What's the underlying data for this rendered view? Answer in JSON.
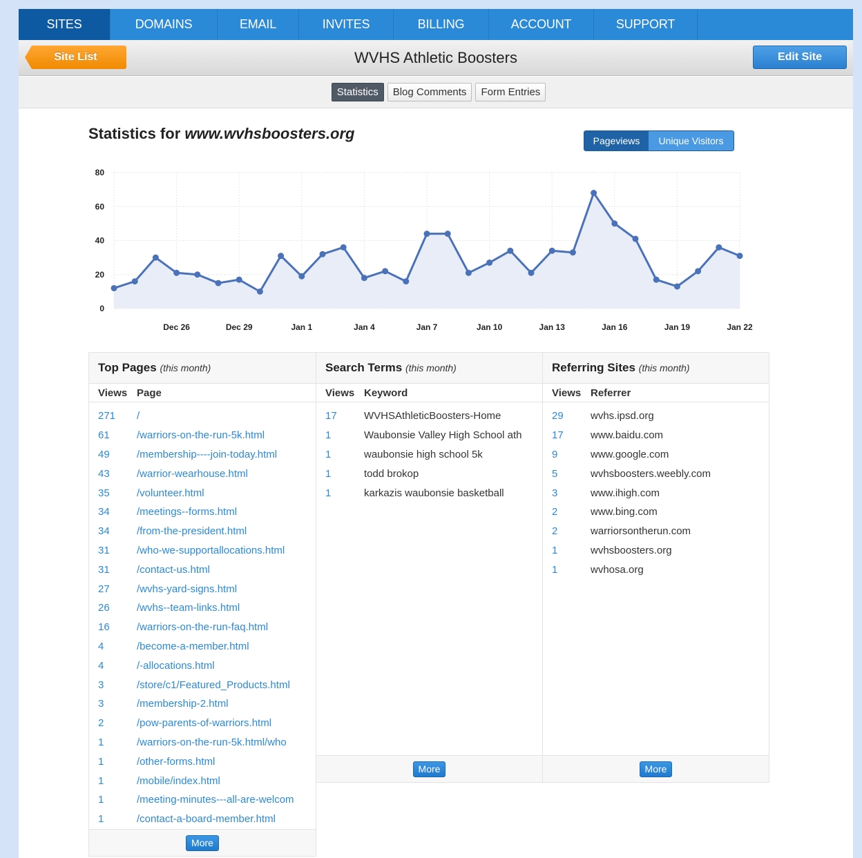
{
  "nav": {
    "items": [
      {
        "label": "SITES",
        "w": 133
      },
      {
        "label": "DOMAINS",
        "w": 155
      },
      {
        "label": "EMAIL",
        "w": 118
      },
      {
        "label": "INVITES",
        "w": 137
      },
      {
        "label": "BILLING",
        "w": 138
      },
      {
        "label": "ACCOUNT",
        "w": 152
      },
      {
        "label": "SUPPORT",
        "w": 150
      }
    ]
  },
  "header": {
    "back_label": "Site List",
    "title": "WVHS Athletic Boosters",
    "edit_label": "Edit Site"
  },
  "subtabs": [
    "Statistics",
    "Blog Comments",
    "Form Entries"
  ],
  "stats": {
    "title_prefix": "Statistics for ",
    "domain": "www.wvhsboosters.org",
    "toggle_pageviews": "Pageviews",
    "toggle_unique": "Unique Visitors"
  },
  "chart_data": {
    "type": "area",
    "x_tick_labels": [
      "Dec 26",
      "Dec 29",
      "Jan 1",
      "Jan 4",
      "Jan 7",
      "Jan 10",
      "Jan 13",
      "Jan 16",
      "Jan 19",
      "Jan 22"
    ],
    "y_ticks": [
      0,
      20,
      40,
      60,
      80
    ],
    "ylim": [
      0,
      80
    ],
    "x_start": "Dec 23",
    "x_end": "Jan 22",
    "values": [
      12,
      16,
      30,
      21,
      20,
      15,
      17,
      10,
      31,
      19,
      32,
      36,
      18,
      22,
      16,
      44,
      44,
      21,
      27,
      34,
      21,
      34,
      33,
      68,
      50,
      41,
      17,
      13,
      22,
      36,
      31
    ],
    "color": "#4a72b8",
    "fill": "#e8edf8",
    "grid": true
  },
  "top_pages": {
    "title": "Top Pages",
    "subtitle": "(this month)",
    "col_views": "Views",
    "col_page": "Page",
    "rows": [
      {
        "views": "271",
        "page": "/"
      },
      {
        "views": "61",
        "page": "/warriors-on-the-run-5k.html"
      },
      {
        "views": "49",
        "page": "/membership----join-today.html"
      },
      {
        "views": "43",
        "page": "/warrior-wearhouse.html"
      },
      {
        "views": "35",
        "page": "/volunteer.html"
      },
      {
        "views": "34",
        "page": "/meetings--forms.html"
      },
      {
        "views": "34",
        "page": "/from-the-president.html"
      },
      {
        "views": "31",
        "page": "/who-we-supportallocations.html"
      },
      {
        "views": "31",
        "page": "/contact-us.html"
      },
      {
        "views": "27",
        "page": "/wvhs-yard-signs.html"
      },
      {
        "views": "26",
        "page": "/wvhs--team-links.html"
      },
      {
        "views": "16",
        "page": "/warriors-on-the-run-faq.html"
      },
      {
        "views": "4",
        "page": "/become-a-member.html"
      },
      {
        "views": "4",
        "page": "/-allocations.html"
      },
      {
        "views": "3",
        "page": "/store/c1/Featured_Products.html"
      },
      {
        "views": "3",
        "page": "/membership-2.html"
      },
      {
        "views": "2",
        "page": "/pow-parents-of-warriors.html"
      },
      {
        "views": "1",
        "page": "/warriors-on-the-run-5k.html/who"
      },
      {
        "views": "1",
        "page": "/other-forms.html"
      },
      {
        "views": "1",
        "page": "/mobile/index.html"
      },
      {
        "views": "1",
        "page": "/meeting-minutes---all-are-welcom"
      },
      {
        "views": "1",
        "page": "/contact-a-board-member.html"
      }
    ],
    "more_label": "More"
  },
  "search_terms": {
    "title": "Search Terms",
    "subtitle": "(this month)",
    "col_views": "Views",
    "col_keyword": "Keyword",
    "rows": [
      {
        "views": "17",
        "keyword": "WVHSAthleticBoosters-Home"
      },
      {
        "views": "1",
        "keyword": "Waubonsie Valley High School ath"
      },
      {
        "views": "1",
        "keyword": "waubonsie high school 5k"
      },
      {
        "views": "1",
        "keyword": "todd brokop"
      },
      {
        "views": "1",
        "keyword": "karkazis waubonsie basketball"
      }
    ],
    "more_label": "More"
  },
  "referring_sites": {
    "title": "Referring Sites",
    "subtitle": "(this month)",
    "col_views": "Views",
    "col_referrer": "Referrer",
    "rows": [
      {
        "views": "29",
        "referrer": "wvhs.ipsd.org"
      },
      {
        "views": "17",
        "referrer": "www.baidu.com"
      },
      {
        "views": "9",
        "referrer": "www.google.com"
      },
      {
        "views": "5",
        "referrer": "wvhsboosters.weebly.com"
      },
      {
        "views": "3",
        "referrer": "www.ihigh.com"
      },
      {
        "views": "2",
        "referrer": "www.bing.com"
      },
      {
        "views": "2",
        "referrer": "warriorsontherun.com"
      },
      {
        "views": "1",
        "referrer": "wvhsboosters.org"
      },
      {
        "views": "1",
        "referrer": "wvhosa.org"
      }
    ],
    "more_label": "More"
  }
}
